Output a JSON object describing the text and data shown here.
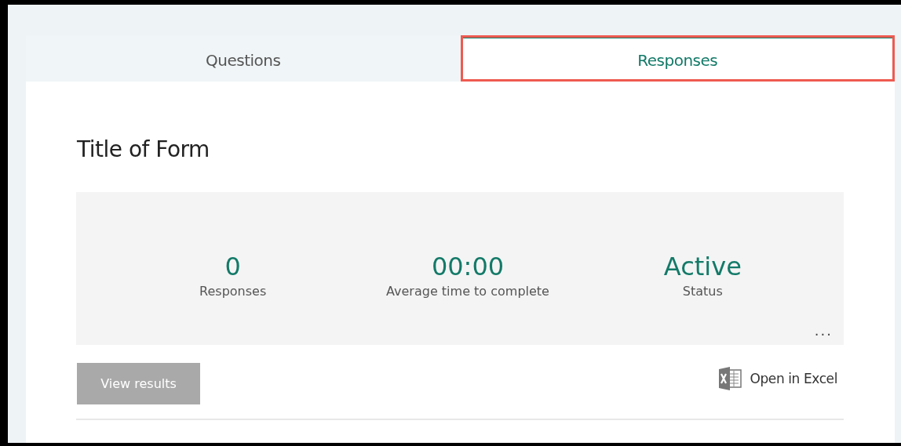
{
  "tabs": [
    {
      "label": "Questions",
      "selected": false,
      "highlighted": false
    },
    {
      "label": "Responses",
      "selected": true,
      "highlighted": true
    }
  ],
  "form_title": "Title of Form",
  "stats": [
    {
      "value": "0",
      "label": "Responses"
    },
    {
      "value": "00:00",
      "label": "Average time to complete"
    },
    {
      "value": "Active",
      "label": "Status"
    }
  ],
  "more_button": "...",
  "view_results": {
    "label": "View results",
    "disabled": true
  },
  "open_in_excel": "Open in Excel"
}
